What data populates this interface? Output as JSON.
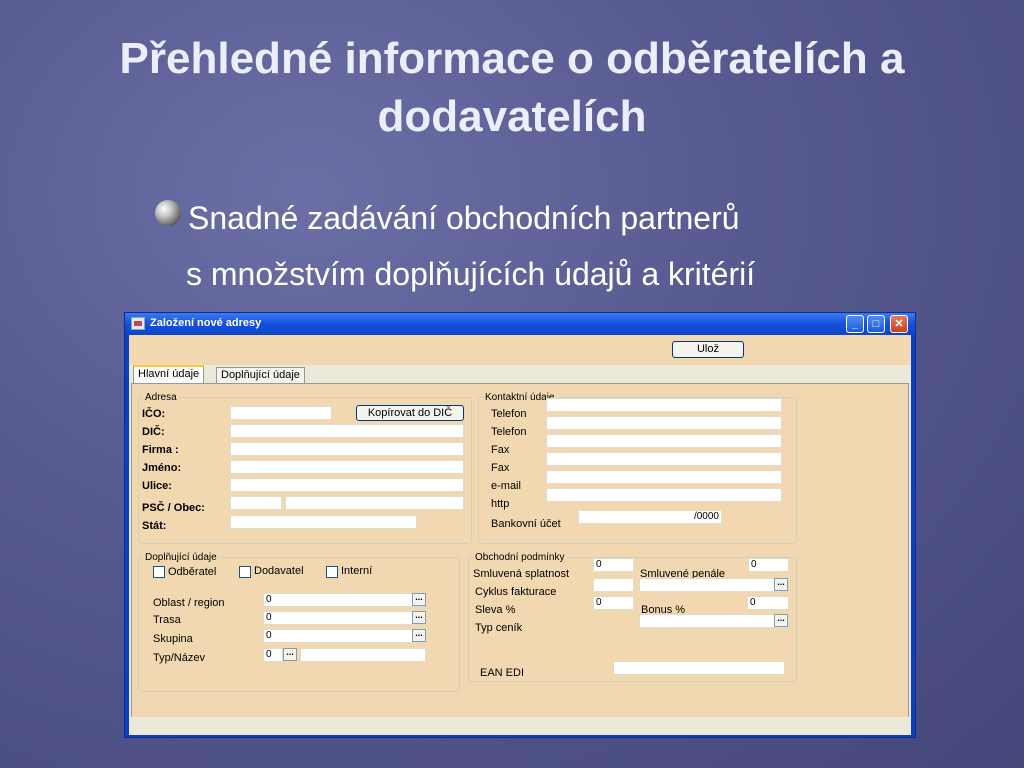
{
  "slide": {
    "title": "Přehledné informace o odběratelích a dodavatelích",
    "title_line1": "Přehledné informace o odběratelích a",
    "title_line2": "dodavatelích",
    "bullet_line1": "Snadné zadávání obchodních partnerů",
    "bullet_line2": "s množstvím doplňujících údajů a kritérií"
  },
  "window": {
    "title": "Založení nové adresy",
    "save_label": "Ulož",
    "tabs": [
      "Hlavní údaje",
      "Doplňující údaje"
    ],
    "active_tab": "Hlavní údaje"
  },
  "address": {
    "legend": "Adresa",
    "ico_label": "IČO:",
    "dic_label": "DIČ:",
    "firma_label": "Firma :",
    "jmeno_label": "Jméno:",
    "ulice_label": "Ulice:",
    "psc_label": "PSČ / Obec:",
    "stat_label": "Stát:",
    "copy_button": "Kopírovat do DIČ"
  },
  "contacts": {
    "legend": "Kontaktní údaje",
    "labels": [
      "Telefon",
      "Telefon",
      "Fax",
      "Fax",
      "e-mail",
      "http"
    ],
    "bank_label": "Bankovní účet",
    "bank_value": "/0000"
  },
  "extra": {
    "legend": "Doplňující údaje",
    "checkboxes": [
      "Odběratel",
      "Dodavatel",
      "Interní"
    ],
    "fields": [
      {
        "label": "Oblast / region",
        "value": "0"
      },
      {
        "label": "Trasa",
        "value": "0"
      },
      {
        "label": "Skupina",
        "value": "0"
      },
      {
        "label": "Typ/Název",
        "value": "0"
      }
    ]
  },
  "terms": {
    "legend": "Obchodní podmínky",
    "splatnost_label": "Smluvená splatnost",
    "splatnost_value": "0",
    "penale_label": "Smluvené penále",
    "penale_value": "0",
    "cyklus_label": "Cyklus fakturace",
    "sleva_label": "Sleva %",
    "sleva_value": "0",
    "bonus_label": "Bonus %",
    "bonus_value": "0",
    "typcenik_label": "Typ ceník",
    "ean_label": "EAN EDI"
  },
  "colors": {
    "background": "#56598f",
    "title_text": "#eceefc",
    "titlebar": "#1450dc",
    "form_bg": "#f1d8b1"
  },
  "icons": [
    "bullet-sphere-icon",
    "app-window-icon",
    "minimize-icon",
    "maximize-icon",
    "close-icon",
    "lookup-dots-icon"
  ]
}
